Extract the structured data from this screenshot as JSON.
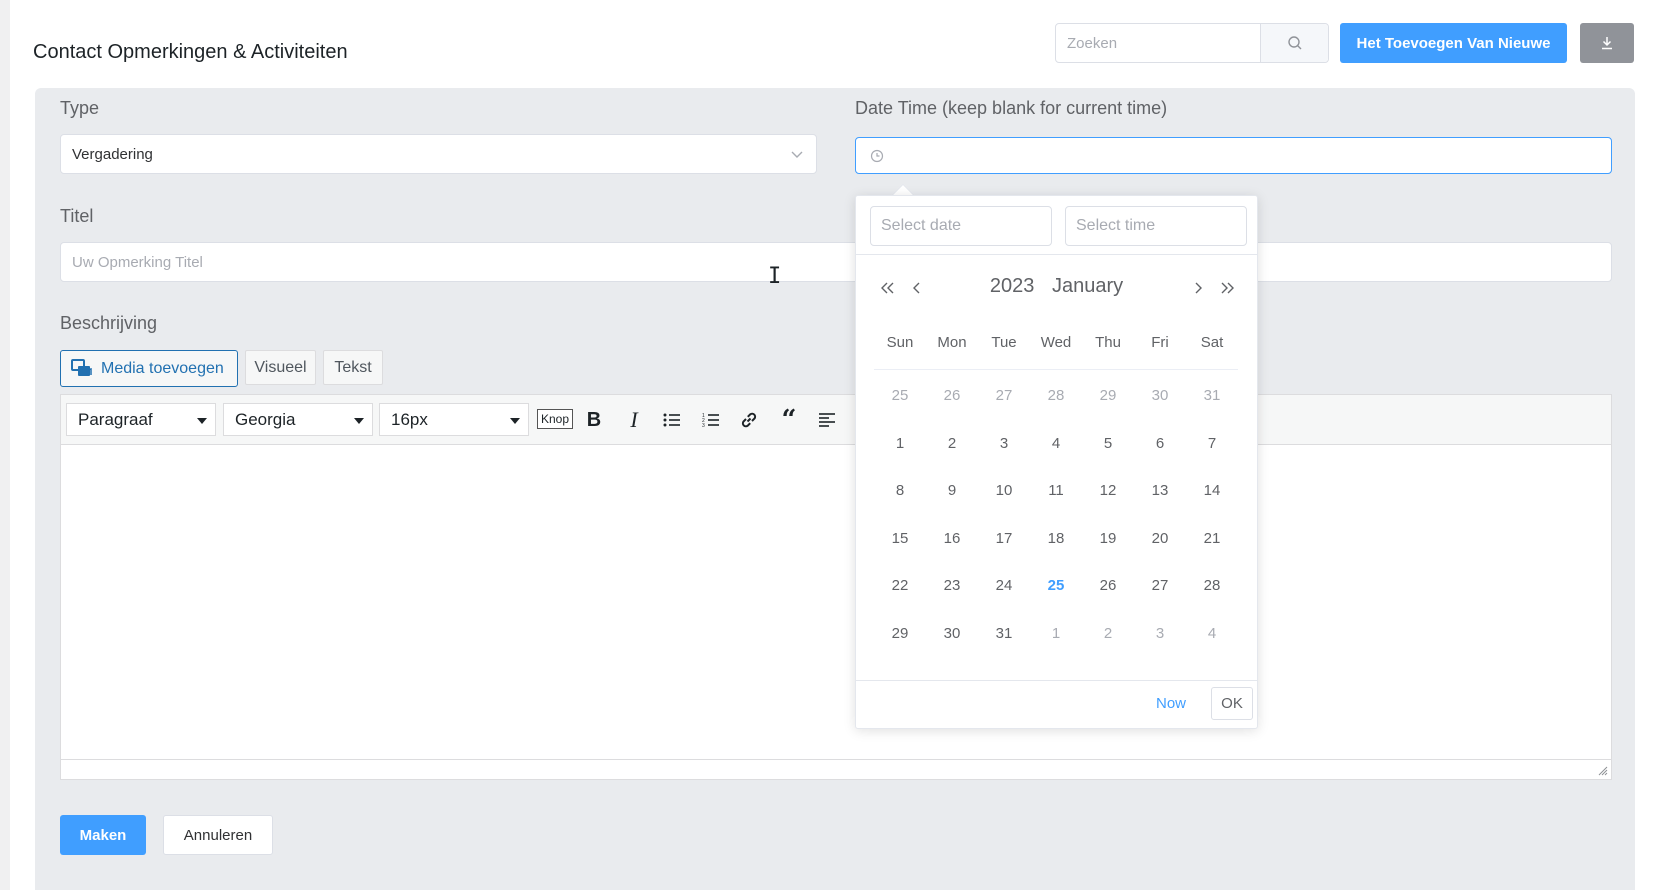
{
  "page": {
    "title": "Contact Opmerkingen & Activiteiten"
  },
  "header": {
    "search_placeholder": "Zoeken",
    "add_button": "Het Toevoegen Van Nieuwe",
    "export_icon": "download-icon"
  },
  "form": {
    "type_label": "Type",
    "type_value": "Vergadering",
    "datetime_label": "Date Time (keep blank for current time)",
    "datetime_value": "",
    "title_label": "Titel",
    "title_placeholder": "Uw Opmerking Titel",
    "description_label": "Beschrijving",
    "media_button": "Media toevoegen",
    "tab_visual": "Visueel",
    "tab_text": "Tekst",
    "toolbar": {
      "format_select": "Paragraaf",
      "font_select": "Georgia",
      "size_select": "16px",
      "knop": "Knop"
    },
    "submit_button": "Maken",
    "cancel_button": "Annuleren"
  },
  "datepicker": {
    "date_placeholder": "Select date",
    "time_placeholder": "Select time",
    "year": "2023",
    "month": "January",
    "weekdays": [
      "Sun",
      "Mon",
      "Tue",
      "Wed",
      "Thu",
      "Fri",
      "Sat"
    ],
    "days": [
      {
        "d": "25",
        "m": true
      },
      {
        "d": "26",
        "m": true
      },
      {
        "d": "27",
        "m": true
      },
      {
        "d": "28",
        "m": true
      },
      {
        "d": "29",
        "m": true
      },
      {
        "d": "30",
        "m": true
      },
      {
        "d": "31",
        "m": true
      },
      {
        "d": "1"
      },
      {
        "d": "2"
      },
      {
        "d": "3"
      },
      {
        "d": "4"
      },
      {
        "d": "5"
      },
      {
        "d": "6"
      },
      {
        "d": "7"
      },
      {
        "d": "8"
      },
      {
        "d": "9"
      },
      {
        "d": "10"
      },
      {
        "d": "11"
      },
      {
        "d": "12"
      },
      {
        "d": "13"
      },
      {
        "d": "14"
      },
      {
        "d": "15"
      },
      {
        "d": "16"
      },
      {
        "d": "17"
      },
      {
        "d": "18"
      },
      {
        "d": "19"
      },
      {
        "d": "20"
      },
      {
        "d": "21"
      },
      {
        "d": "22"
      },
      {
        "d": "23"
      },
      {
        "d": "24"
      },
      {
        "d": "25",
        "today": true
      },
      {
        "d": "26"
      },
      {
        "d": "27"
      },
      {
        "d": "28"
      },
      {
        "d": "29"
      },
      {
        "d": "30"
      },
      {
        "d": "31"
      },
      {
        "d": "1",
        "m": true
      },
      {
        "d": "2",
        "m": true
      },
      {
        "d": "3",
        "m": true
      },
      {
        "d": "4",
        "m": true
      }
    ],
    "now_button": "Now",
    "ok_button": "OK"
  },
  "colors": {
    "accent": "#409eff",
    "panel_bg": "#e9ebee",
    "muted_text": "#a8abb2"
  }
}
